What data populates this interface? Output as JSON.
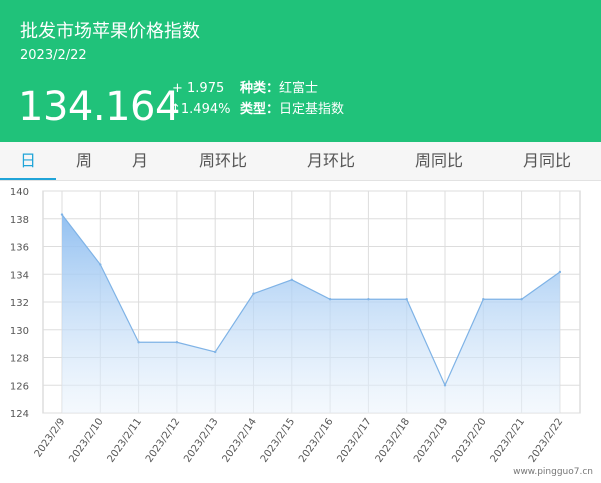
{
  "header": {
    "title": "批发市场苹果价格指数",
    "date": "2023/2/22",
    "price": "134.164",
    "change": "+ 1.975",
    "change_pct": "↑1.494%",
    "kind_label": "种类：",
    "kind_value": "红富士",
    "type_label": "类型：",
    "type_value": "日定基指数"
  },
  "tabs": [
    {
      "label": "日",
      "active": true
    },
    {
      "label": "周",
      "active": false
    },
    {
      "label": "月",
      "active": false
    },
    {
      "label": "周环比",
      "active": false
    },
    {
      "label": "月环比",
      "active": false
    },
    {
      "label": "周同比",
      "active": false
    },
    {
      "label": "月同比",
      "active": false
    }
  ],
  "watermark": "www.pingguo7.cn",
  "colors": {
    "header_bg": "#20c27a",
    "active_tab": "#20a4d8",
    "line": "#7fb3e6",
    "area_top": "#8dbdf0",
    "grid": "#dddddd"
  },
  "chart_data": {
    "type": "area",
    "x": [
      "2023/2/9",
      "2023/2/10",
      "2023/2/11",
      "2023/2/12",
      "2023/2/13",
      "2023/2/14",
      "2023/2/15",
      "2023/2/16",
      "2023/2/17",
      "2023/2/18",
      "2023/2/19",
      "2023/2/20",
      "2023/2/21",
      "2023/2/22"
    ],
    "values": [
      138.3,
      134.7,
      129.1,
      129.1,
      128.4,
      132.6,
      133.6,
      132.2,
      132.2,
      132.2,
      126.0,
      132.2,
      132.2,
      134.164
    ],
    "ylim": [
      124,
      140
    ],
    "yticks": [
      124,
      126,
      128,
      130,
      132,
      134,
      136,
      138,
      140
    ],
    "grid": true,
    "legend": "none"
  }
}
